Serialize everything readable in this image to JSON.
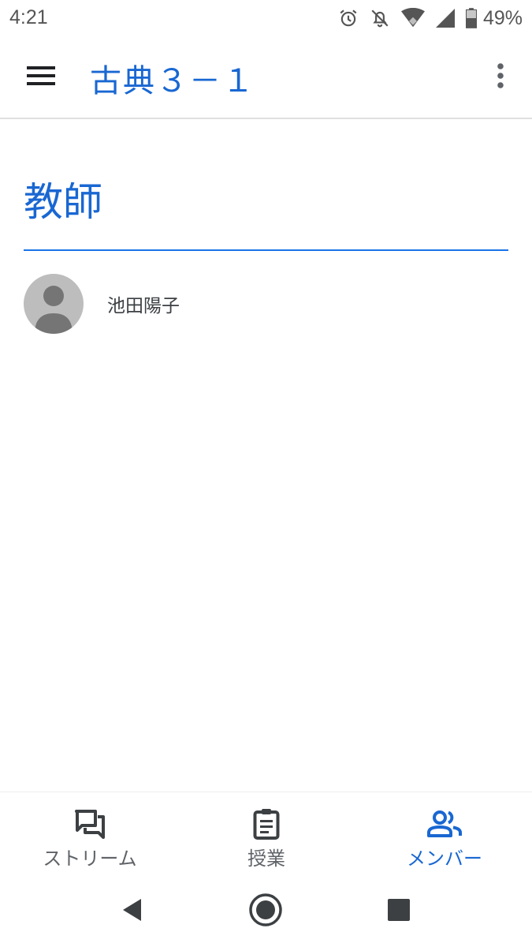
{
  "status_bar": {
    "time": "4:21",
    "battery_percent": "49%",
    "icons": [
      "alarm-icon",
      "notifications-off-icon",
      "wifi-icon",
      "cell-signal-icon",
      "battery-icon"
    ]
  },
  "app_bar": {
    "title": "古典３－１",
    "menu_icon": "hamburger-menu-icon",
    "more_icon": "more-vert-icon"
  },
  "content": {
    "section_title": "教師",
    "members": [
      {
        "name": "池田陽子",
        "avatar_icon": "default-avatar-icon"
      }
    ]
  },
  "bottom_nav": {
    "tabs": [
      {
        "label": "ストリーム",
        "icon": "stream-icon",
        "active": false
      },
      {
        "label": "授業",
        "icon": "classwork-icon",
        "active": false
      },
      {
        "label": "メンバー",
        "icon": "people-icon",
        "active": true
      }
    ]
  },
  "system_nav": {
    "buttons": [
      "back-icon",
      "home-icon",
      "recents-icon"
    ]
  },
  "colors": {
    "accent": "#1967d2",
    "divider_accent": "#1a73e8",
    "icon_gray": "#5f6368",
    "avatar_bg": "#bdbdbd",
    "avatar_fg": "#757575"
  }
}
